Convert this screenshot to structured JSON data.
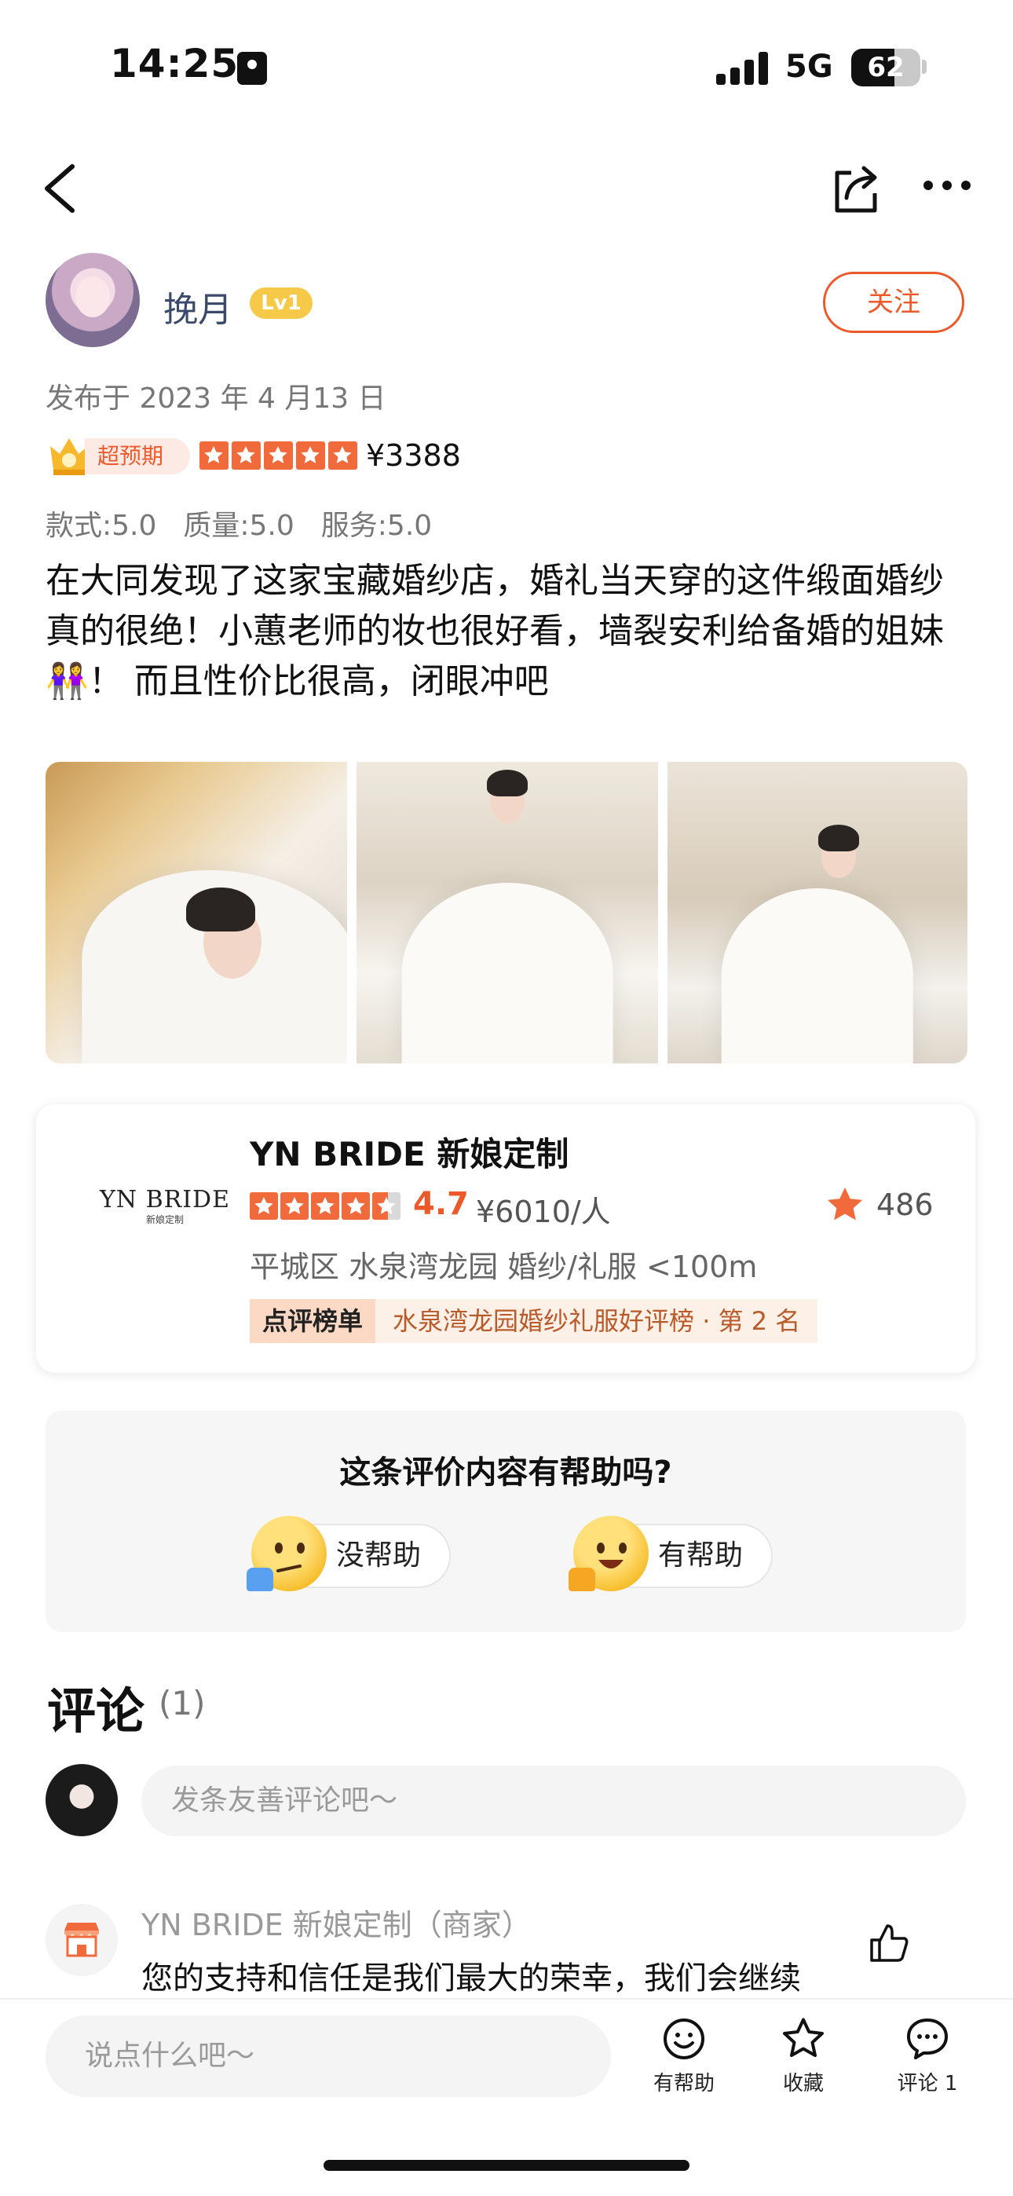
{
  "status_bar": {
    "time": "14:25",
    "network": "5G",
    "battery": "62",
    "battery_level": 0.62
  },
  "nav": {
    "back_icon": "chevron-left-icon",
    "share_icon": "share-icon",
    "more_icon": "more-icon"
  },
  "author": {
    "name": "挽月",
    "level": "Lv1",
    "follow_label": "关注"
  },
  "review": {
    "publish_date": "发布于 2023 年 4 月13 日",
    "exceed_tag": "超预期",
    "rating": 5,
    "price": "¥3388",
    "sub_scores": [
      "款式:5.0",
      "质量:5.0",
      "服务:5.0"
    ],
    "text_1": "在大同发现了这家宝藏婚纱店，婚礼当天穿的这件缎面婚纱真的很绝！小蕙老师的妆也很好看，墙裂安利给备婚的姐妹",
    "emoji": "👭",
    "text_2": "！ 而且性价比很高，闭眼冲吧"
  },
  "shop": {
    "logo": "YN BRIDE",
    "logo_sub": "新娘定制",
    "name": "YN BRIDE 新娘定制",
    "rating": 4.7,
    "score": "4.7",
    "avg_price": "¥6010/人",
    "fav_count": "486",
    "location": "平城区 水泉湾龙园 婚纱/礼服   <100m",
    "rank_left": "点评榜单",
    "rank_right": "水泉湾龙园婚纱礼服好评榜 · 第 2 名"
  },
  "helpful": {
    "title": "这条评价内容有帮助吗?",
    "no_label": "没帮助",
    "yes_label": "有帮助"
  },
  "comments": {
    "heading": "评论",
    "count": "(1)",
    "input_placeholder": "发条友善评论吧～",
    "items": [
      {
        "author": "YN BRIDE 新娘定制（商家）",
        "text": "您的支持和信任是我们最大的荣幸，我们会继续"
      }
    ]
  },
  "bottom_bar": {
    "input_placeholder": "说点什么吧～",
    "helpful_label": "有帮助",
    "fav_label": "收藏",
    "comment_label": "评论 1"
  },
  "colors": {
    "accent": "#ec5a2b",
    "star": "#f06a3c",
    "level": "#f7c948"
  }
}
